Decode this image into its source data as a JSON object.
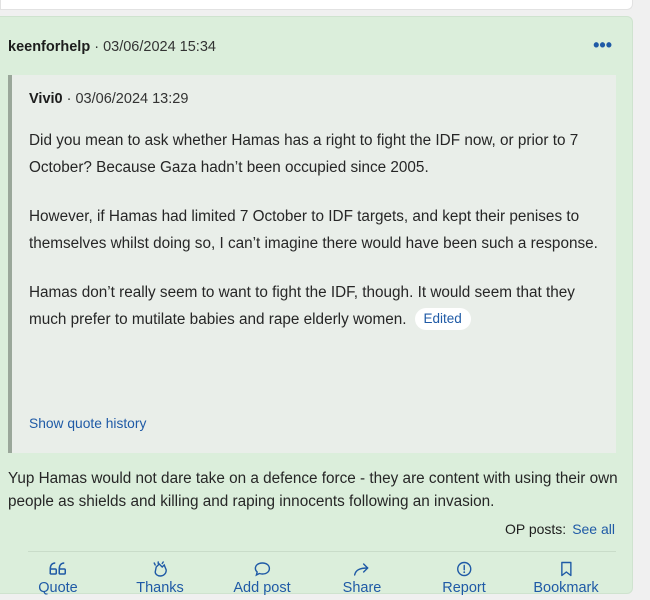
{
  "post": {
    "author": "keenforhelp",
    "meta": "· 03/06/2024 15:34",
    "more": "•••",
    "quote": {
      "author": "Vivi0",
      "meta": "· 03/06/2024 13:29",
      "paragraphs": [
        "Did you mean to ask whether Hamas has a right to fight the IDF now, or prior to 7 October? Because Gaza hadn’t been occupied since 2005.",
        "However, if Hamas had limited 7 October to IDF targets, and kept their penises to themselves whilst doing so, I can’t imagine there would have been such a response.",
        "Hamas don’t really seem to want to fight the IDF, though. It would seem that they much prefer to mutilate babies and rape elderly women."
      ],
      "edited_badge": "Edited",
      "history_link": "Show quote history"
    },
    "body": "Yup Hamas would not dare take on a defence force - they are content with using their own people as shields and killing and raping innocents following an invasion.",
    "op_posts_label": "OP posts:",
    "see_all": "See all",
    "actions": {
      "quote": "Quote",
      "thanks": "Thanks",
      "add_post": "Add post",
      "share": "Share",
      "report": "Report",
      "bookmark": "Bookmark"
    }
  },
  "colors": {
    "post_bg": "#dbeedb",
    "quote_bg": "#e9eee9",
    "link": "#1f5aa6"
  }
}
